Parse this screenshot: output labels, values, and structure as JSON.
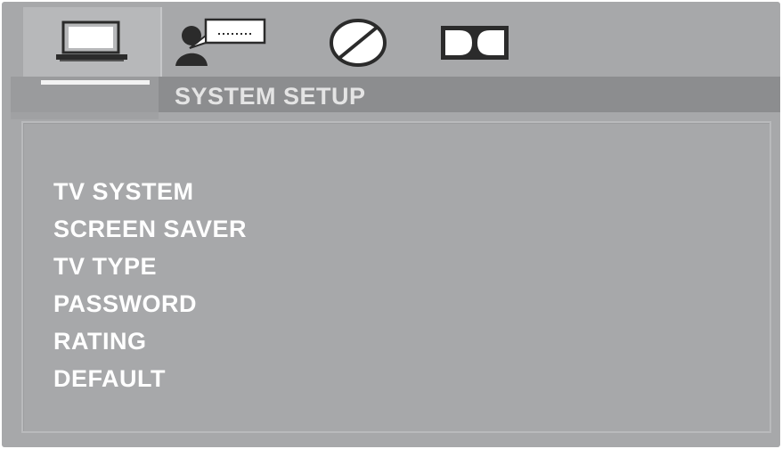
{
  "header": {
    "title": "SYSTEM SETUP"
  },
  "tabs": [
    {
      "icon": "tv-monitor-icon",
      "active": true
    },
    {
      "icon": "language-speaker-icon",
      "active": false
    },
    {
      "icon": "audio-disc-icon",
      "active": false
    },
    {
      "icon": "dolby-logo-icon",
      "active": false
    }
  ],
  "menu": {
    "items": [
      {
        "label": "TV SYSTEM"
      },
      {
        "label": "SCREEN SAVER"
      },
      {
        "label": "TV TYPE"
      },
      {
        "label": "PASSWORD"
      },
      {
        "label": "RATING"
      },
      {
        "label": "DEFAULT"
      }
    ]
  },
  "colors": {
    "background": "#a7a8aa",
    "title_band": "#8c8d8f",
    "text": "#ffffff",
    "underline": "#f2f2f2"
  }
}
